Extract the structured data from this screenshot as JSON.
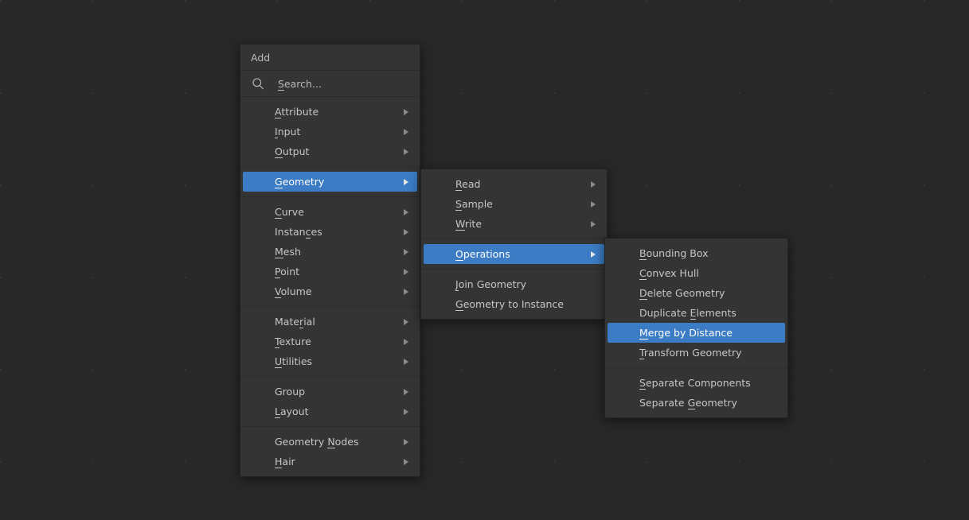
{
  "app": {
    "background_color": "#282828",
    "accent_color": "#3b7cc4",
    "panel_color": "#343434"
  },
  "add_menu": {
    "title": "Add",
    "search": {
      "icon": "search-icon",
      "placeholder": "Search...",
      "value": "",
      "accel": "S"
    },
    "groups": [
      {
        "items": [
          {
            "label": "Attribute",
            "accel_index": 0,
            "submenu": true
          },
          {
            "label": "Input",
            "accel_index": 0,
            "submenu": true
          },
          {
            "label": "Output",
            "accel_index": 0,
            "submenu": true
          }
        ]
      },
      {
        "items": [
          {
            "label": "Geometry",
            "accel_index": 0,
            "submenu": true,
            "selected": true
          }
        ]
      },
      {
        "items": [
          {
            "label": "Curve",
            "accel_index": 0,
            "submenu": true
          },
          {
            "label": "Instances",
            "accel_index": 6,
            "submenu": true
          },
          {
            "label": "Mesh",
            "accel_index": 0,
            "submenu": true
          },
          {
            "label": "Point",
            "accel_index": 0,
            "submenu": true
          },
          {
            "label": "Volume",
            "accel_index": 0,
            "submenu": true
          }
        ]
      },
      {
        "items": [
          {
            "label": "Material",
            "accel_index": 4,
            "submenu": true
          },
          {
            "label": "Texture",
            "accel_index": 0,
            "submenu": true
          },
          {
            "label": "Utilities",
            "accel_index": 0,
            "submenu": true
          }
        ]
      },
      {
        "items": [
          {
            "label": "Group",
            "accel_index": -1,
            "submenu": true
          },
          {
            "label": "Layout",
            "accel_index": 0,
            "submenu": true
          }
        ]
      },
      {
        "items": [
          {
            "label": "Geometry Nodes",
            "accel_index": 9,
            "submenu": true
          },
          {
            "label": "Hair",
            "accel_index": 0,
            "submenu": true
          }
        ]
      }
    ]
  },
  "geometry_menu": {
    "groups": [
      {
        "items": [
          {
            "label": "Read",
            "accel_index": 0,
            "submenu": true
          },
          {
            "label": "Sample",
            "accel_index": 0,
            "submenu": true
          },
          {
            "label": "Write",
            "accel_index": 0,
            "submenu": true
          }
        ]
      },
      {
        "items": [
          {
            "label": "Operations",
            "accel_index": 0,
            "submenu": true,
            "selected": true
          }
        ]
      },
      {
        "items": [
          {
            "label": "Join Geometry",
            "accel_index": 0,
            "submenu": false
          },
          {
            "label": "Geometry to Instance",
            "accel_index": 0,
            "submenu": false
          }
        ]
      }
    ]
  },
  "operations_menu": {
    "groups": [
      {
        "items": [
          {
            "label": "Bounding Box",
            "accel_index": 0,
            "submenu": false
          },
          {
            "label": "Convex Hull",
            "accel_index": 0,
            "submenu": false
          },
          {
            "label": "Delete Geometry",
            "accel_index": 0,
            "submenu": false
          },
          {
            "label": "Duplicate Elements",
            "accel_index": 10,
            "submenu": false
          },
          {
            "label": "Merge by Distance",
            "accel_index": 0,
            "submenu": false,
            "selected": true
          },
          {
            "label": "Transform Geometry",
            "accel_index": 0,
            "submenu": false
          }
        ]
      },
      {
        "items": [
          {
            "label": "Separate Components",
            "accel_index": 0,
            "submenu": false
          },
          {
            "label": "Separate Geometry",
            "accel_index": 9,
            "submenu": false
          }
        ]
      }
    ]
  }
}
